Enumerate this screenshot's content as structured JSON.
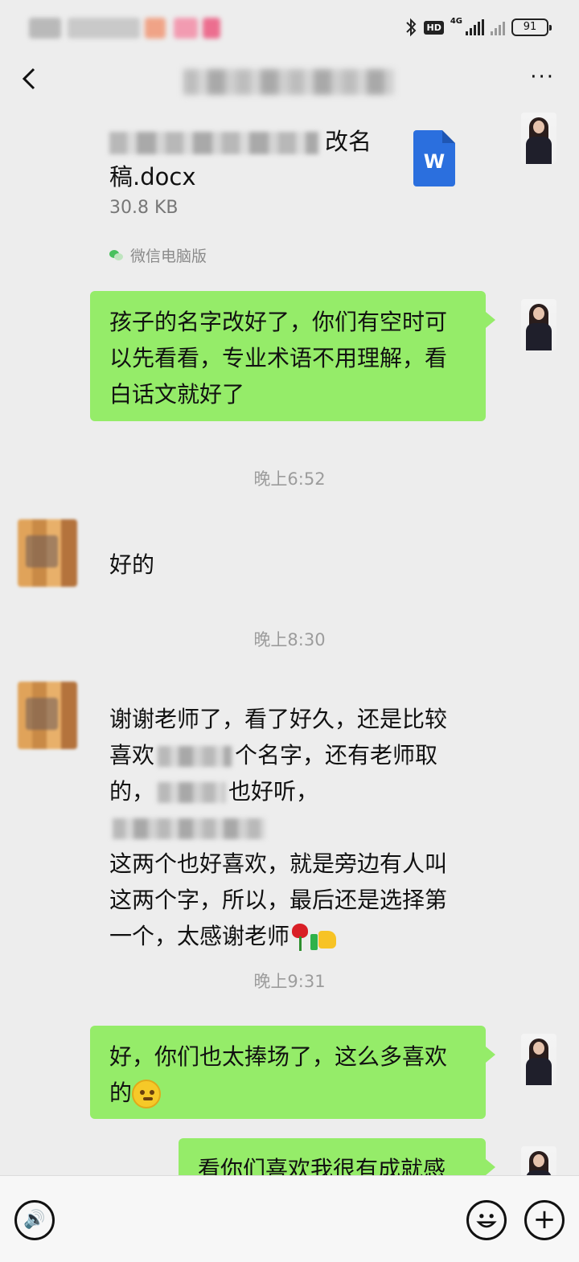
{
  "status_bar": {
    "network": "4G",
    "hd_label": "HD",
    "battery": "91"
  },
  "header": {
    "title": "",
    "more_label": "···"
  },
  "messages": {
    "file": {
      "name_suffix": "改名",
      "name_line2": "稿.docx",
      "size": "30.8 KB",
      "source": "微信电脑版",
      "icon_letter": "W"
    },
    "msg1": "孩子的名字改好了，你们有空时可以先看看，专业术语不用理解，看白话文就好了",
    "time1": "晚上6:52",
    "msg2": "好的",
    "time2": "晚上8:30",
    "msg3": {
      "line1": "谢谢老师了，看了好久，还是比较",
      "line2_start": "喜欢",
      "line2_end": "个名字，还有老师取",
      "line3_start": "的，",
      "line3_mid": "也好听，",
      "line4": "这两个也好喜欢，就是旁边有人叫",
      "line5": "这两个字，所以，最后还是选择第",
      "line6": "一个，太感谢老师"
    },
    "time3": "晚上9:31",
    "msg4_line1": "好，你们也太捧场了，这么多喜欢",
    "msg4_line2": "的",
    "msg5": "看你们喜欢我很有成就感"
  },
  "icons": [
    "back-icon",
    "more-icon",
    "word-file-icon",
    "voice-icon",
    "emoji-icon",
    "plus-icon",
    "bluetooth-icon",
    "signal-icon",
    "battery-icon"
  ],
  "colors": {
    "bubble_self": "#95ec69",
    "background": "#ededed",
    "timestamp": "#9c9c9c"
  }
}
